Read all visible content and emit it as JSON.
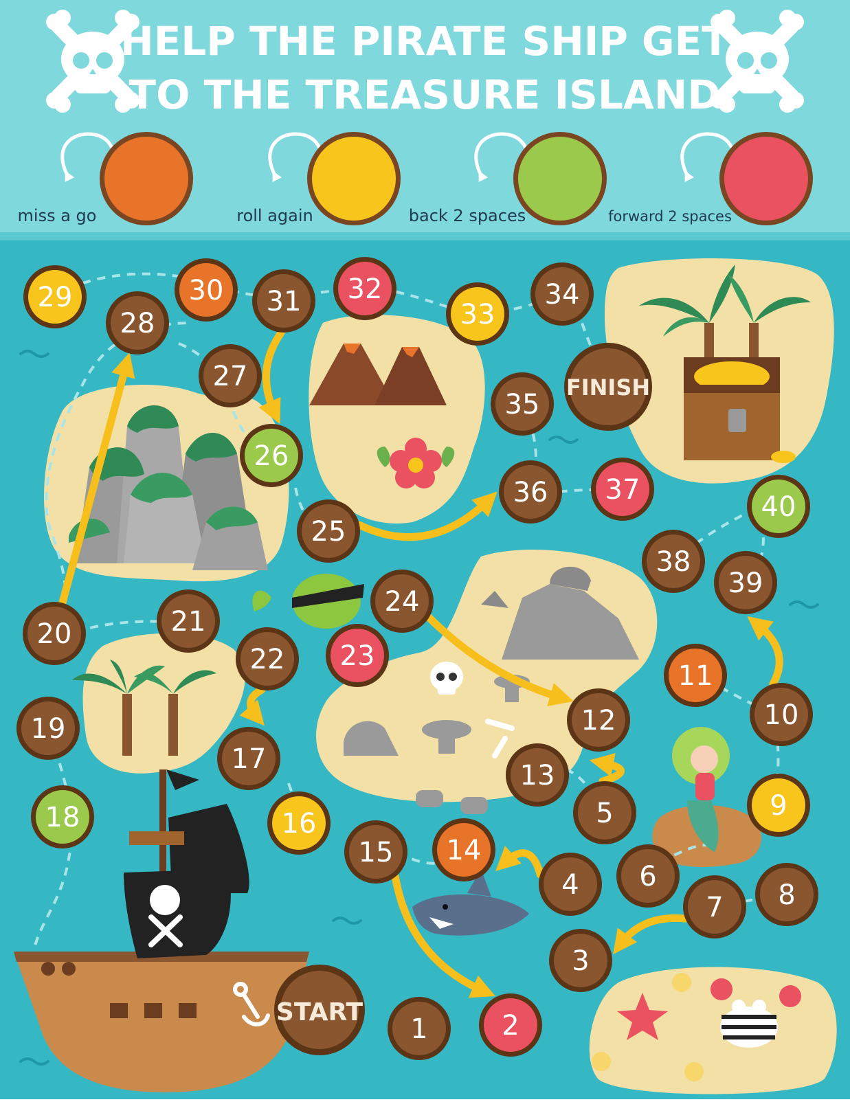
{
  "header": {
    "title_line1": "HELP THE PIRATE SHIP GET",
    "title_line2": "TO THE TREASURE ISLAND"
  },
  "legend": [
    {
      "label": "miss a go",
      "color": "#e8742a"
    },
    {
      "label": "roll again",
      "color": "#f7c51c"
    },
    {
      "label": "back 2 spaces",
      "color": "#9bc94b"
    },
    {
      "label": "forward 2 spaces",
      "color": "#ea5261"
    }
  ],
  "board": {
    "start_label": "START",
    "finish_label": "FINISH",
    "colors": {
      "sea": "#35b7c4",
      "header_bg": "#7fd8dc",
      "sand": "#f3e0a6",
      "space_brown": "#8a5630",
      "arrow": "#f7bf1c"
    },
    "spaces": [
      {
        "n": "1",
        "type": "plain"
      },
      {
        "n": "2",
        "type": "forward"
      },
      {
        "n": "3",
        "type": "plain"
      },
      {
        "n": "4",
        "type": "plain"
      },
      {
        "n": "5",
        "type": "plain"
      },
      {
        "n": "6",
        "type": "plain"
      },
      {
        "n": "7",
        "type": "plain"
      },
      {
        "n": "8",
        "type": "plain"
      },
      {
        "n": "9",
        "type": "roll"
      },
      {
        "n": "10",
        "type": "plain"
      },
      {
        "n": "11",
        "type": "miss"
      },
      {
        "n": "12",
        "type": "plain"
      },
      {
        "n": "13",
        "type": "plain"
      },
      {
        "n": "14",
        "type": "miss"
      },
      {
        "n": "15",
        "type": "plain"
      },
      {
        "n": "16",
        "type": "roll"
      },
      {
        "n": "17",
        "type": "plain"
      },
      {
        "n": "18",
        "type": "back"
      },
      {
        "n": "19",
        "type": "plain"
      },
      {
        "n": "20",
        "type": "plain"
      },
      {
        "n": "21",
        "type": "plain"
      },
      {
        "n": "22",
        "type": "plain"
      },
      {
        "n": "23",
        "type": "forward"
      },
      {
        "n": "24",
        "type": "plain"
      },
      {
        "n": "25",
        "type": "plain"
      },
      {
        "n": "26",
        "type": "back"
      },
      {
        "n": "27",
        "type": "plain"
      },
      {
        "n": "28",
        "type": "plain"
      },
      {
        "n": "29",
        "type": "roll"
      },
      {
        "n": "30",
        "type": "miss"
      },
      {
        "n": "31",
        "type": "plain"
      },
      {
        "n": "32",
        "type": "forward"
      },
      {
        "n": "33",
        "type": "roll"
      },
      {
        "n": "34",
        "type": "plain"
      },
      {
        "n": "35",
        "type": "plain"
      },
      {
        "n": "36",
        "type": "plain"
      },
      {
        "n": "37",
        "type": "forward"
      },
      {
        "n": "38",
        "type": "plain"
      },
      {
        "n": "39",
        "type": "plain"
      },
      {
        "n": "40",
        "type": "back"
      }
    ],
    "shortcuts": [
      {
        "from": "20",
        "to": "28"
      },
      {
        "from": "31",
        "to": "26"
      },
      {
        "from": "25",
        "to": "36"
      },
      {
        "from": "24",
        "to": "12"
      },
      {
        "from": "22",
        "to": "17"
      },
      {
        "from": "10",
        "to": "39"
      },
      {
        "from": "5",
        "to": "12"
      },
      {
        "from": "4",
        "to": "14"
      },
      {
        "from": "7",
        "to": "3"
      },
      {
        "from": "15",
        "to": "2"
      }
    ]
  }
}
